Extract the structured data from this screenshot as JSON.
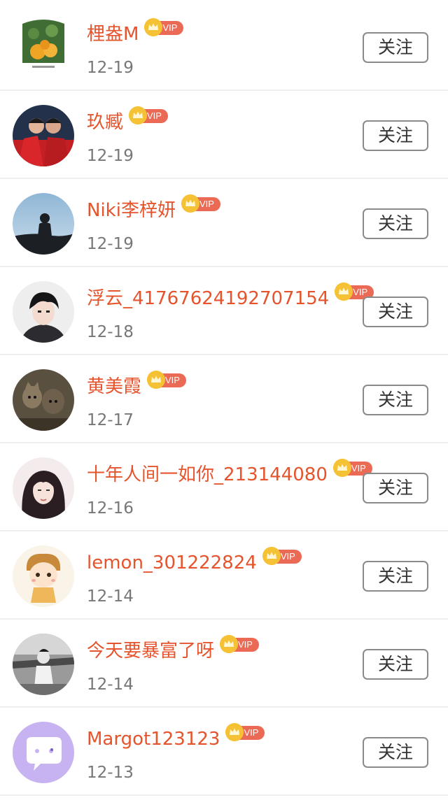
{
  "follow_label": "关注",
  "vip_label": "VIP",
  "users": [
    {
      "name": "梩盎M",
      "date": "12-19"
    },
    {
      "name": "玖臧",
      "date": "12-19"
    },
    {
      "name": "Niki李梓妍",
      "date": "12-19"
    },
    {
      "name": "浮云_41767624192707154",
      "date": "12-18"
    },
    {
      "name": "黄美霞",
      "date": "12-17"
    },
    {
      "name": "十年人间一如你_213144080",
      "date": "12-16"
    },
    {
      "name": "lemon_301222824",
      "date": "12-14"
    },
    {
      "name": "今天要暴富了呀",
      "date": "12-14"
    },
    {
      "name": "Margot123123",
      "date": "12-13"
    }
  ],
  "colors": {
    "name": "#e5542d",
    "vip_badge": "#ea6a55",
    "crown": "#f6c235",
    "date": "#777777"
  }
}
